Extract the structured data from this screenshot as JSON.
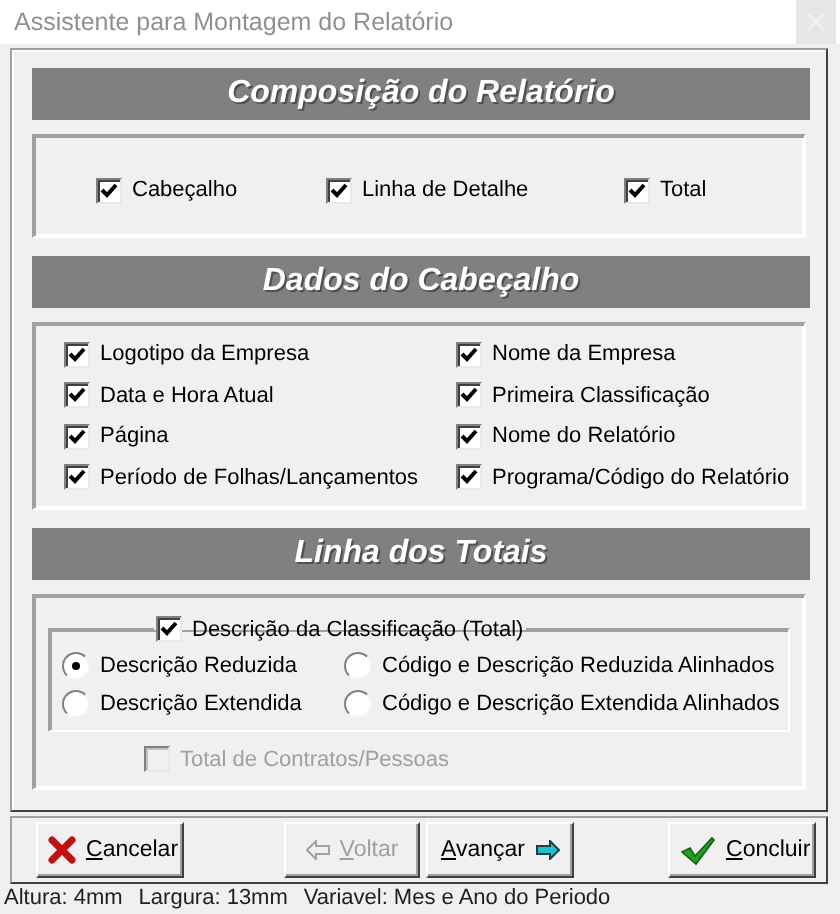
{
  "window": {
    "title": "Assistente para Montagem do Relatório"
  },
  "sections": [
    {
      "title": "Composição do Relatório",
      "kind": "row",
      "options": [
        {
          "label": "Cabeçalho",
          "checked": true
        },
        {
          "label": "Linha de Detalhe",
          "checked": true
        },
        {
          "label": "Total",
          "checked": true
        }
      ]
    },
    {
      "title": "Dados do Cabeçalho",
      "kind": "grid",
      "options": [
        {
          "label": "Logotipo da Empresa",
          "checked": true
        },
        {
          "label": "Nome da Empresa",
          "checked": true
        },
        {
          "label": "Data e Hora Atual",
          "checked": true
        },
        {
          "label": "Primeira Classificação",
          "checked": true
        },
        {
          "label": "Página",
          "checked": true
        },
        {
          "label": "Nome do Relatório",
          "checked": true
        },
        {
          "label": "Período de Folhas/Lançamentos",
          "checked": true
        },
        {
          "label": "Programa/Código do Relatório",
          "checked": true
        }
      ]
    },
    {
      "title": "Linha dos Totais",
      "kind": "totals",
      "group": {
        "label": "Descrição da Classificação (Total)",
        "checked": true,
        "radios": [
          {
            "label": "Descrição Reduzida",
            "selected": true
          },
          {
            "label": "Código e Descrição Reduzida Alinhados",
            "selected": false
          },
          {
            "label": "Descrição Extendida",
            "selected": false
          },
          {
            "label": "Código e Descrição Extendida Alinhados",
            "selected": false
          }
        ]
      },
      "options": [
        {
          "label": "Total de Contratos/Pessoas",
          "checked": false,
          "disabled": true
        }
      ]
    }
  ],
  "buttons": [
    {
      "label": "Cancelar",
      "kind": "cancel",
      "disabled": false
    },
    {
      "label": "Voltar",
      "kind": "back",
      "disabled": true
    },
    {
      "label": "Avançar",
      "kind": "next",
      "disabled": false
    },
    {
      "label": "Concluir",
      "kind": "finish",
      "disabled": false
    }
  ],
  "status_bar": [
    "Altura: 4mm",
    "Largura: 13mm",
    "Variavel: Mes e Ano do Periodo"
  ]
}
